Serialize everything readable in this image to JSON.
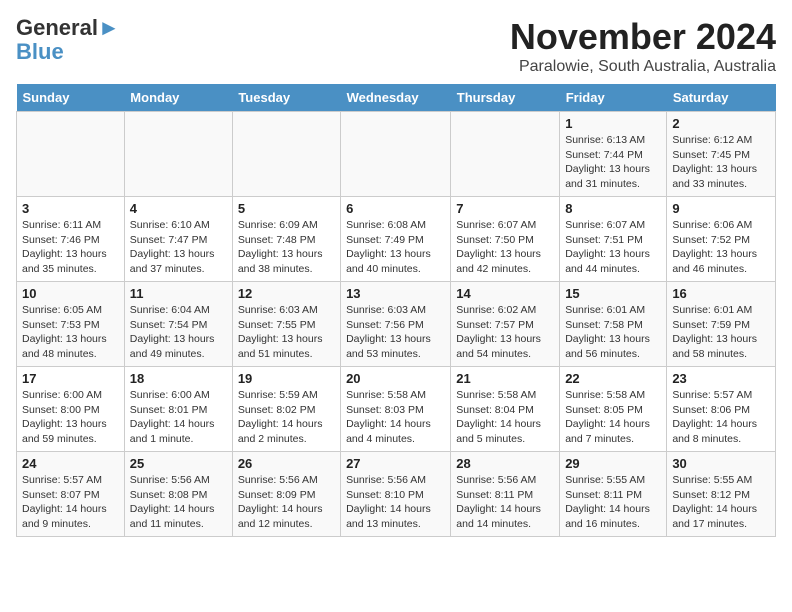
{
  "header": {
    "logo_line1": "General",
    "logo_line2": "Blue",
    "title": "November 2024",
    "subtitle": "Paralowie, South Australia, Australia"
  },
  "calendar": {
    "days_of_week": [
      "Sunday",
      "Monday",
      "Tuesday",
      "Wednesday",
      "Thursday",
      "Friday",
      "Saturday"
    ],
    "weeks": [
      {
        "cells": [
          {
            "day": null,
            "info": null
          },
          {
            "day": null,
            "info": null
          },
          {
            "day": null,
            "info": null
          },
          {
            "day": null,
            "info": null
          },
          {
            "day": null,
            "info": null
          },
          {
            "day": "1",
            "info": "Sunrise: 6:13 AM\nSunset: 7:44 PM\nDaylight: 13 hours\nand 31 minutes."
          },
          {
            "day": "2",
            "info": "Sunrise: 6:12 AM\nSunset: 7:45 PM\nDaylight: 13 hours\nand 33 minutes."
          }
        ]
      },
      {
        "cells": [
          {
            "day": "3",
            "info": "Sunrise: 6:11 AM\nSunset: 7:46 PM\nDaylight: 13 hours\nand 35 minutes."
          },
          {
            "day": "4",
            "info": "Sunrise: 6:10 AM\nSunset: 7:47 PM\nDaylight: 13 hours\nand 37 minutes."
          },
          {
            "day": "5",
            "info": "Sunrise: 6:09 AM\nSunset: 7:48 PM\nDaylight: 13 hours\nand 38 minutes."
          },
          {
            "day": "6",
            "info": "Sunrise: 6:08 AM\nSunset: 7:49 PM\nDaylight: 13 hours\nand 40 minutes."
          },
          {
            "day": "7",
            "info": "Sunrise: 6:07 AM\nSunset: 7:50 PM\nDaylight: 13 hours\nand 42 minutes."
          },
          {
            "day": "8",
            "info": "Sunrise: 6:07 AM\nSunset: 7:51 PM\nDaylight: 13 hours\nand 44 minutes."
          },
          {
            "day": "9",
            "info": "Sunrise: 6:06 AM\nSunset: 7:52 PM\nDaylight: 13 hours\nand 46 minutes."
          }
        ]
      },
      {
        "cells": [
          {
            "day": "10",
            "info": "Sunrise: 6:05 AM\nSunset: 7:53 PM\nDaylight: 13 hours\nand 48 minutes."
          },
          {
            "day": "11",
            "info": "Sunrise: 6:04 AM\nSunset: 7:54 PM\nDaylight: 13 hours\nand 49 minutes."
          },
          {
            "day": "12",
            "info": "Sunrise: 6:03 AM\nSunset: 7:55 PM\nDaylight: 13 hours\nand 51 minutes."
          },
          {
            "day": "13",
            "info": "Sunrise: 6:03 AM\nSunset: 7:56 PM\nDaylight: 13 hours\nand 53 minutes."
          },
          {
            "day": "14",
            "info": "Sunrise: 6:02 AM\nSunset: 7:57 PM\nDaylight: 13 hours\nand 54 minutes."
          },
          {
            "day": "15",
            "info": "Sunrise: 6:01 AM\nSunset: 7:58 PM\nDaylight: 13 hours\nand 56 minutes."
          },
          {
            "day": "16",
            "info": "Sunrise: 6:01 AM\nSunset: 7:59 PM\nDaylight: 13 hours\nand 58 minutes."
          }
        ]
      },
      {
        "cells": [
          {
            "day": "17",
            "info": "Sunrise: 6:00 AM\nSunset: 8:00 PM\nDaylight: 13 hours\nand 59 minutes."
          },
          {
            "day": "18",
            "info": "Sunrise: 6:00 AM\nSunset: 8:01 PM\nDaylight: 14 hours\nand 1 minute."
          },
          {
            "day": "19",
            "info": "Sunrise: 5:59 AM\nSunset: 8:02 PM\nDaylight: 14 hours\nand 2 minutes."
          },
          {
            "day": "20",
            "info": "Sunrise: 5:58 AM\nSunset: 8:03 PM\nDaylight: 14 hours\nand 4 minutes."
          },
          {
            "day": "21",
            "info": "Sunrise: 5:58 AM\nSunset: 8:04 PM\nDaylight: 14 hours\nand 5 minutes."
          },
          {
            "day": "22",
            "info": "Sunrise: 5:58 AM\nSunset: 8:05 PM\nDaylight: 14 hours\nand 7 minutes."
          },
          {
            "day": "23",
            "info": "Sunrise: 5:57 AM\nSunset: 8:06 PM\nDaylight: 14 hours\nand 8 minutes."
          }
        ]
      },
      {
        "cells": [
          {
            "day": "24",
            "info": "Sunrise: 5:57 AM\nSunset: 8:07 PM\nDaylight: 14 hours\nand 9 minutes."
          },
          {
            "day": "25",
            "info": "Sunrise: 5:56 AM\nSunset: 8:08 PM\nDaylight: 14 hours\nand 11 minutes."
          },
          {
            "day": "26",
            "info": "Sunrise: 5:56 AM\nSunset: 8:09 PM\nDaylight: 14 hours\nand 12 minutes."
          },
          {
            "day": "27",
            "info": "Sunrise: 5:56 AM\nSunset: 8:10 PM\nDaylight: 14 hours\nand 13 minutes."
          },
          {
            "day": "28",
            "info": "Sunrise: 5:56 AM\nSunset: 8:11 PM\nDaylight: 14 hours\nand 14 minutes."
          },
          {
            "day": "29",
            "info": "Sunrise: 5:55 AM\nSunset: 8:11 PM\nDaylight: 14 hours\nand 16 minutes."
          },
          {
            "day": "30",
            "info": "Sunrise: 5:55 AM\nSunset: 8:12 PM\nDaylight: 14 hours\nand 17 minutes."
          }
        ]
      }
    ]
  }
}
